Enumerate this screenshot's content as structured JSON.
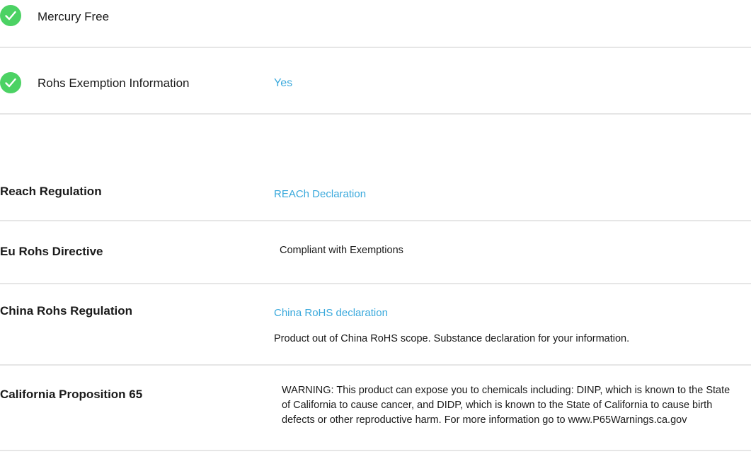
{
  "attributes": [
    {
      "label": "Mercury Free",
      "value": "",
      "icon": "check-circle-icon"
    },
    {
      "label": "Rohs Exemption Information",
      "value": "Yes",
      "icon": "check-circle-icon"
    }
  ],
  "regulations": {
    "reach": {
      "label": "Reach Regulation",
      "link": "REACh Declaration"
    },
    "eu_rohs": {
      "label": "Eu Rohs Directive",
      "text": "Compliant with Exemptions"
    },
    "china_rohs": {
      "label": "China Rohs Regulation",
      "link": "China RoHS declaration",
      "text": "Product out of China RoHS scope. Substance declaration for your information."
    },
    "prop65": {
      "label": "California Proposition 65",
      "text": "WARNING: This product can expose you to chemicals including: DINP, which is known to the State of California to cause cancer, and DIDP, which is known to the State of California to cause birth defects or other reproductive harm. For more information go to www.P65Warnings.ca.gov"
    }
  },
  "colors": {
    "check_green": "#4cd264",
    "link_blue": "#3aa9dc",
    "divider": "#e6e6e6"
  }
}
